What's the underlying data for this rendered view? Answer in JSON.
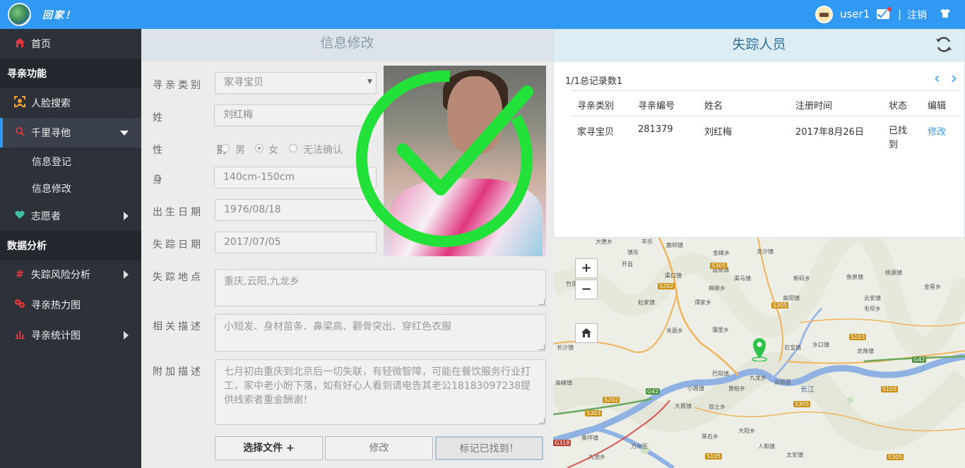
{
  "topbar": {
    "brand": "回家！",
    "username": "user1",
    "separator": "|",
    "logout": "注销"
  },
  "sidebar": {
    "home": "首页",
    "section_search": "寻亲功能",
    "face_search": "人脸搜索",
    "qianli": "千里寻他",
    "sub_register": "信息登记",
    "sub_modify": "信息修改",
    "volunteer": "志愿者",
    "section_analysis": "数据分析",
    "risk_analysis": "失踪风险分析",
    "heatmap": "寻亲热力图",
    "stats": "寻亲统计图"
  },
  "form": {
    "title": "信息修改",
    "labels": {
      "category": "寻亲类别",
      "name": "姓 名",
      "gender": "性 别",
      "height": "身 高",
      "birth": "出生日期",
      "missing_date": "失踪日期",
      "missing_place": "失踪地点",
      "description": "相关描述",
      "extra": "附加描述"
    },
    "category_value": "家寻宝贝",
    "name_value": "刘红梅",
    "gender_options": [
      "男",
      "女",
      "无法确认"
    ],
    "gender_selected": "女",
    "height_value": "140cm-150cm",
    "birth_value": "1976/08/18",
    "missing_date_value": "2017/07/05",
    "missing_place_value": "重庆,云阳,九龙乡",
    "description_value": "小短发、身材苗条、鼻梁高、颧骨突出、穿红色衣服",
    "extra_value": "七月初由重庆到北京后一切失联，有轻微智障，可能在餐饮服务行业打工，家中老小盼下落，如有好心人看到请电告其老公18183097238提供线索者重金酬谢！",
    "buttons": {
      "choose_file": "选择文件 +",
      "modify": "修改",
      "mark_found": "标记已找到！"
    },
    "check_color": "#22e23a"
  },
  "missing": {
    "title": "失踪人员",
    "record_count": "1/1总记录数1",
    "pager_prev": "‹",
    "pager_next": "›",
    "columns": [
      "寻亲类别",
      "寻亲编号",
      "姓名",
      "注册时间",
      "状态",
      "编辑"
    ],
    "rows": [
      {
        "category": "家寻宝贝",
        "id": "281379",
        "name": "刘红梅",
        "reg_time": "2017年8月26日",
        "status": "已找到",
        "edit": "修改"
      }
    ]
  },
  "map": {
    "zoom_in": "+",
    "zoom_out": "−",
    "home_icon": "home-icon",
    "labels": [
      "大德乡",
      "丰乐",
      "鹿圳镇",
      "开县",
      "镇东",
      "渠口镇",
      "金峰乡",
      "龙沙镇",
      "温泉镇",
      "麻柳乡",
      "竹溪",
      "赵家镇",
      "谭家乡",
      "S202",
      "S305",
      "渠马镇",
      "新码乡",
      "鱼泉镇",
      "长沙镇",
      "关面乡",
      "蒲里乡",
      "九龙乡",
      "云阳县",
      "长江",
      "高阳镇",
      "S305",
      "巴阳镇",
      "小周镇",
      "大周镇",
      "水口镇",
      "S103",
      "S105",
      "G42",
      "G42",
      "石宝镇",
      "双土乡",
      "黄柏乡",
      "龙角镇",
      "云安镇",
      "毛坝乡",
      "S303",
      "S202",
      "高峰镇",
      "万州区",
      "九池乡",
      "黑石乡",
      "G318",
      "S105",
      "S305",
      "S305",
      "桃源镇",
      "金星乡",
      "大阳乡",
      "人和镇",
      "太安镇",
      "桑坪镇"
    ],
    "accent": "#2f99f3"
  }
}
